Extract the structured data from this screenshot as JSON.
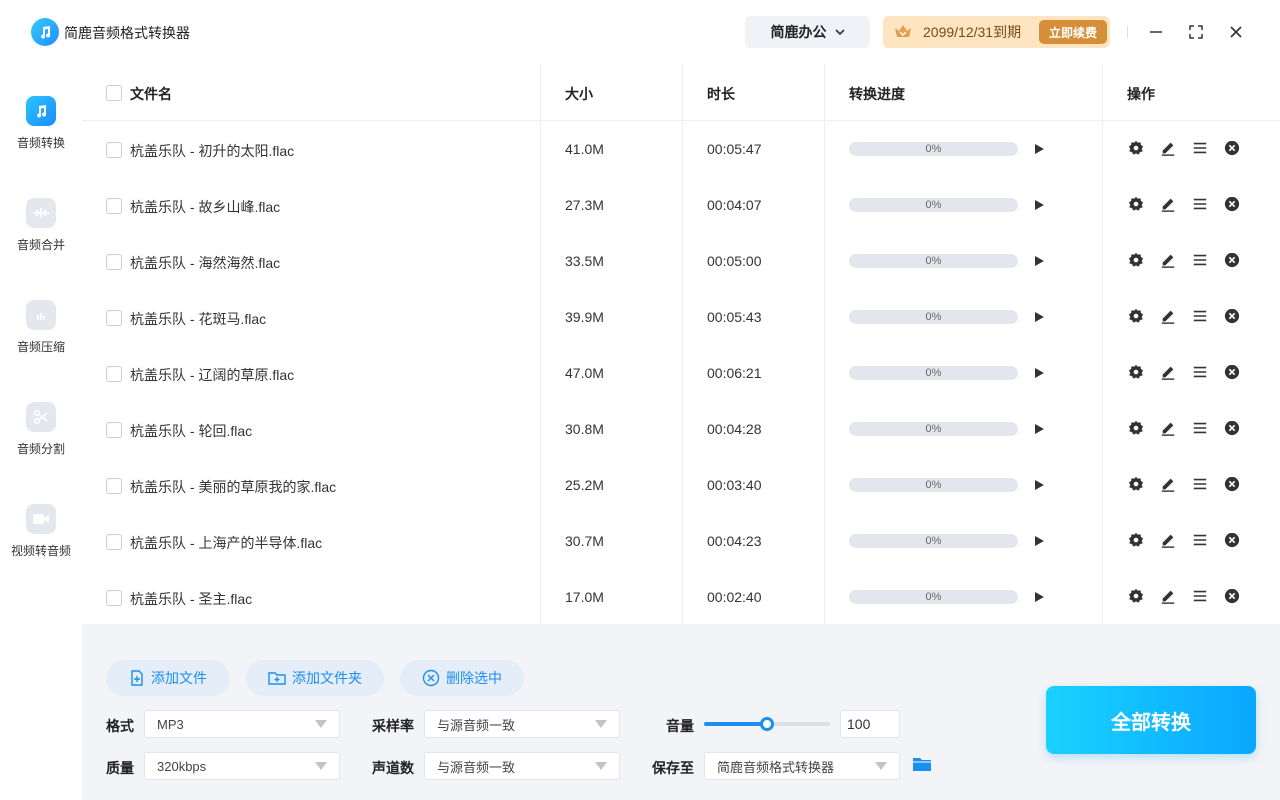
{
  "app": {
    "title": "简鹿音频格式转换器"
  },
  "header": {
    "brand_menu": "简鹿办公",
    "vip_expiry": "2099/12/31到期",
    "renew_label": "立即续费"
  },
  "sidebar": {
    "items": [
      {
        "label": "音频转换",
        "icon": "music-note-icon",
        "active": true
      },
      {
        "label": "音频合并",
        "icon": "merge-icon"
      },
      {
        "label": "音频压缩",
        "icon": "compress-file-icon"
      },
      {
        "label": "音频分割",
        "icon": "scissors-icon"
      },
      {
        "label": "视频转音频",
        "icon": "video-camera-icon"
      }
    ]
  },
  "table": {
    "columns": [
      "文件名",
      "大小",
      "时长",
      "转换进度",
      "操作"
    ],
    "rows": [
      {
        "name": "杭盖乐队 - 初升的太阳.flac",
        "size": "41.0M",
        "duration": "00:05:47",
        "progress": "0%"
      },
      {
        "name": "杭盖乐队 - 故乡山峰.flac",
        "size": "27.3M",
        "duration": "00:04:07",
        "progress": "0%"
      },
      {
        "name": "杭盖乐队 - 海然海然.flac",
        "size": "33.5M",
        "duration": "00:05:00",
        "progress": "0%"
      },
      {
        "name": "杭盖乐队 - 花斑马.flac",
        "size": "39.9M",
        "duration": "00:05:43",
        "progress": "0%"
      },
      {
        "name": "杭盖乐队 - 辽阔的草原.flac",
        "size": "47.0M",
        "duration": "00:06:21",
        "progress": "0%"
      },
      {
        "name": "杭盖乐队 - 轮回.flac",
        "size": "30.8M",
        "duration": "00:04:28",
        "progress": "0%"
      },
      {
        "name": "杭盖乐队 - 美丽的草原我的家.flac",
        "size": "25.2M",
        "duration": "00:03:40",
        "progress": "0%"
      },
      {
        "name": "杭盖乐队 - 上海产的半导体.flac",
        "size": "30.7M",
        "duration": "00:04:23",
        "progress": "0%"
      },
      {
        "name": "杭盖乐队 - 圣主.flac",
        "size": "17.0M",
        "duration": "00:02:40",
        "progress": "0%"
      }
    ]
  },
  "actions": {
    "add_file": "添加文件",
    "add_folder": "添加文件夹",
    "delete_selected": "删除选中",
    "convert_all": "全部转换"
  },
  "settings": {
    "format_label": "格式",
    "format_value": "MP3",
    "quality_label": "质量",
    "quality_value": "320kbps",
    "samplerate_label": "采样率",
    "samplerate_value": "与源音频一致",
    "channels_label": "声道数",
    "channels_value": "与源音频一致",
    "volume_label": "音量",
    "volume_value": "100",
    "volume_level": 0.5,
    "saveto_label": "保存至",
    "saveto_value": "简鹿音频格式转换器"
  },
  "colors": {
    "accent": "#1a8ff0",
    "vip_bg": "#fde5c2",
    "vip_btn": "#d78e38"
  }
}
